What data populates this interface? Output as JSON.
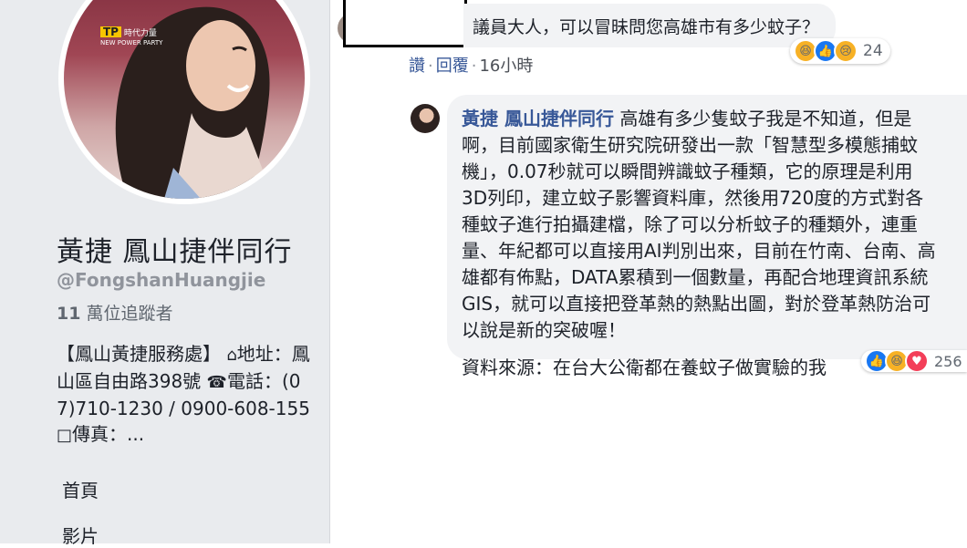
{
  "profile": {
    "name": "黃捷 鳳山捷伴同行",
    "handle": "@FongshanHuangjie",
    "followers_count": "11",
    "followers_label": "萬位追蹤者",
    "about_part1": "【鳳山黃捷服務處】",
    "about_home_icon": "⌂",
    "about_part2": "地址：鳳山區自由路398號",
    "about_phone_icon": "☎",
    "about_part3": "電話：(07)710-1230 / 0900-608-155",
    "about_fax_icon": "□",
    "about_part4": "傳真：...",
    "avatar_logo": "時代力量",
    "avatar_logo_sub": "NEW POWER PARTY"
  },
  "nav": {
    "home": "首頁",
    "videos": "影片"
  },
  "comment": {
    "text": "議員大人，可以冒昧問您高雄市有多少蚊子？",
    "reaction_count": "24",
    "actions": {
      "like": "讚",
      "reply": "回覆",
      "time": "16小時"
    }
  },
  "reply": {
    "author": "黃捷 鳳山捷伴同行",
    "body": "高雄有多少隻蚊子我是不知道，但是啊，目前國家衛生研究院研發出一款「智慧型多模態捕蚊機」，0.07秒就可以瞬間辨識蚊子種類，它的原理是利用3D列印，建立蚊子影響資料庫，然後用720度的方式對各種蚊子進行拍攝建檔，除了可以分析蚊子的種類外，連重量、年紀都可以直接用AI判別出來，目前在竹南、台南、高雄都有佈點，DATA累積到一個數量，再配合地理資訊系統GIS，就可以直接把登革熱的熱點出圖，對於登革熱防治可以說是新的突破喔！",
    "source": "資料來源：在台大公衛都在養蚊子做實驗的我",
    "reaction_count": "256"
  },
  "icons": {
    "haha": "haha-reaction-icon",
    "like": "like-reaction-icon",
    "sad": "sad-reaction-icon",
    "love": "love-reaction-icon"
  },
  "colors": {
    "link": "#385898",
    "sidebar_bg": "#e9ebee",
    "bubble_bg": "#f2f3f5",
    "like_blue": "#1877f2",
    "love_red": "#f33e58",
    "haha_yellow": "#f7b125"
  }
}
